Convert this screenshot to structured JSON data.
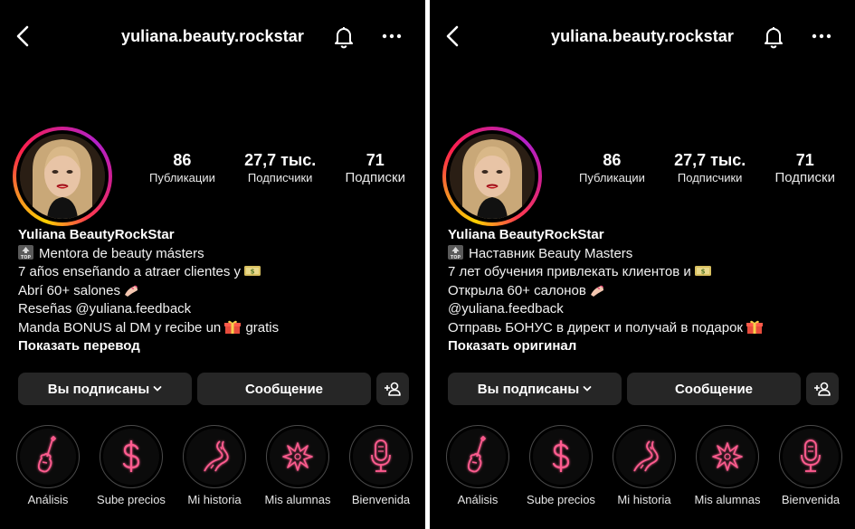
{
  "colors": {
    "background": "#000000",
    "button_bg": "#262626",
    "neon_pink": "#ff5b8f",
    "story_ring": "#d21f8c"
  },
  "panels": [
    {
      "username": "yuliana.beauty.rockstar",
      "stats": {
        "posts": {
          "value": "86",
          "label": "Публикации"
        },
        "followers": {
          "value": "27,7 тыс.",
          "label": "Подписчики"
        },
        "following": {
          "value": "71",
          "label": "Подписки"
        }
      },
      "bio": {
        "name": "Yuliana BeautyRockStar",
        "line1": "Mentora de beauty másters",
        "line2": "7 años enseñando a atraer clientes y",
        "line3": "Abrí 60+ salones",
        "line4": "Reseñas @yuliana.feedback",
        "line5a": "Manda BONUS al DM y recibe un",
        "line5b": "gratis"
      },
      "translate_link": "Показать перевод",
      "buttons": {
        "follow": "Вы подписаны",
        "message": "Сообщение"
      },
      "highlights": [
        "Análisis",
        "Sube precios",
        "Mi historia",
        "Mis alumnas",
        "Bienvenida"
      ]
    },
    {
      "username": "yuliana.beauty.rockstar",
      "stats": {
        "posts": {
          "value": "86",
          "label": "Публикации"
        },
        "followers": {
          "value": "27,7 тыс.",
          "label": "Подписчики"
        },
        "following": {
          "value": "71",
          "label": "Подписки"
        }
      },
      "bio": {
        "name": "Yuliana BeautyRockStar",
        "line1": "Наставник Beauty Masters",
        "line2": "7 лет обучения привлекать клиентов и",
        "line3": "Открыла 60+ салонов",
        "line4": "@yuliana.feedback",
        "line5a": "Отправь БОНУС в директ и получай в подарок",
        "line5b": ""
      },
      "translate_link": "Показать оригинал",
      "buttons": {
        "follow": "Вы подписаны",
        "message": "Сообщение"
      },
      "highlights": [
        "Análisis",
        "Sube precios",
        "Mi historia",
        "Mis alumnas",
        "Bienvenida"
      ]
    }
  ],
  "icons": {
    "back": "chevron-left-icon",
    "bell": "bell-icon",
    "more": "more-dots-icon",
    "add_user": "add-user-icon",
    "highlights": [
      "guitar-icon",
      "dollar-icon",
      "road-icon",
      "starburst-icon",
      "microphone-icon"
    ]
  }
}
